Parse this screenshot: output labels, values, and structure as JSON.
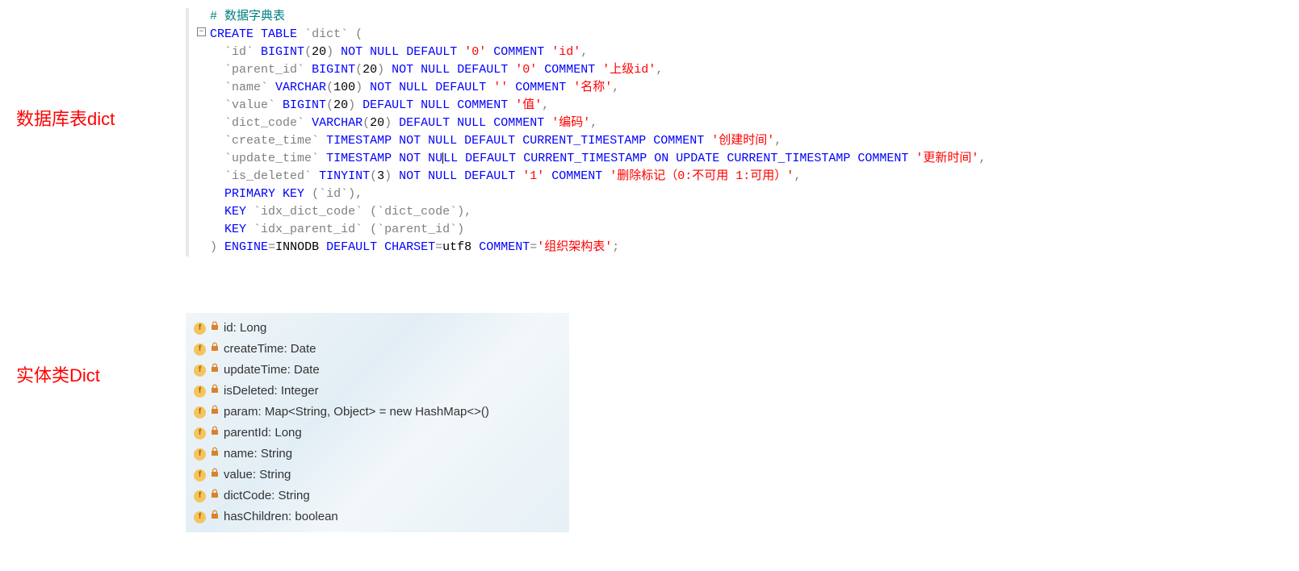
{
  "labels": {
    "db_table": "数据库表dict",
    "entity_class": "实体类Dict"
  },
  "sql": {
    "comment_header": "# 数据字典表",
    "lines": [
      {
        "raw": "CREATE TABLE `dict` ("
      },
      {
        "raw": "  `id` BIGINT(20) NOT NULL DEFAULT '0' COMMENT 'id',"
      },
      {
        "raw": "  `parent_id` BIGINT(20) NOT NULL DEFAULT '0' COMMENT '上级id',"
      },
      {
        "raw": "  `name` VARCHAR(100) NOT NULL DEFAULT '' COMMENT '名称',"
      },
      {
        "raw": "  `value` BIGINT(20) DEFAULT NULL COMMENT '值',"
      },
      {
        "raw": "  `dict_code` VARCHAR(20) DEFAULT NULL COMMENT '编码',"
      },
      {
        "raw": "  `create_time` TIMESTAMP NOT NULL DEFAULT CURRENT_TIMESTAMP COMMENT '创建时间',"
      },
      {
        "raw": "  `update_time` TIMESTAMP NOT NULL DEFAULT CURRENT_TIMESTAMP ON UPDATE CURRENT_TIMESTAMP COMMENT '更新时间',"
      },
      {
        "raw": "  `is_deleted` TINYINT(3) NOT NULL DEFAULT '1' COMMENT '删除标记（0:不可用 1:可用）',"
      },
      {
        "raw": "  PRIMARY KEY (`id`),"
      },
      {
        "raw": "  KEY `idx_dict_code` (`dict_code`),"
      },
      {
        "raw": "  KEY `idx_parent_id` (`parent_id`)"
      },
      {
        "raw": ") ENGINE=INNODB DEFAULT CHARSET=utf8 COMMENT='组织架构表';"
      }
    ]
  },
  "entity": {
    "fields": [
      "id: Long",
      "createTime: Date",
      "updateTime: Date",
      "isDeleted: Integer",
      "param: Map<String, Object> = new HashMap<>()",
      "parentId: Long",
      "name: String",
      "value: String",
      "dictCode: String",
      "hasChildren: boolean"
    ]
  }
}
